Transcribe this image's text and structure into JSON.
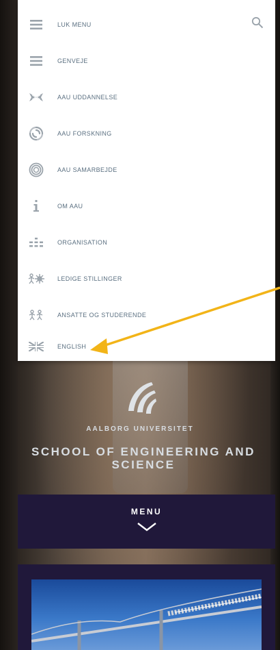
{
  "menu": {
    "items": [
      {
        "label": "LUK MENU",
        "icon": "hamburger-icon"
      },
      {
        "label": "GENVEJE",
        "icon": "hamburger-icon"
      },
      {
        "label": "AAU UDDANNELSE",
        "icon": "education-icon"
      },
      {
        "label": "AAU FORSKNING",
        "icon": "research-icon"
      },
      {
        "label": "AAU SAMARBEJDE",
        "icon": "collaboration-icon"
      },
      {
        "label": "OM AAU",
        "icon": "info-icon"
      },
      {
        "label": "ORGANISATION",
        "icon": "organisation-icon"
      },
      {
        "label": "LEDIGE STILLINGER",
        "icon": "jobs-icon"
      },
      {
        "label": "ANSATTE OG STUDERENDE",
        "icon": "people-icon"
      },
      {
        "label": "ENGLISH",
        "icon": "uk-flag-icon"
      }
    ],
    "search_icon": "search-icon"
  },
  "brand": {
    "university": "AALBORG UNIVERSITET",
    "school": "SCHOOL OF ENGINEERING AND SCIENCE"
  },
  "menu_button": {
    "label": "MENU",
    "icon": "chevron-down-icon"
  },
  "colors": {
    "menu_text": "#5a6f80",
    "icon": "#9aa3ab",
    "navy": "#20183a",
    "arrow": "#f2b418"
  }
}
